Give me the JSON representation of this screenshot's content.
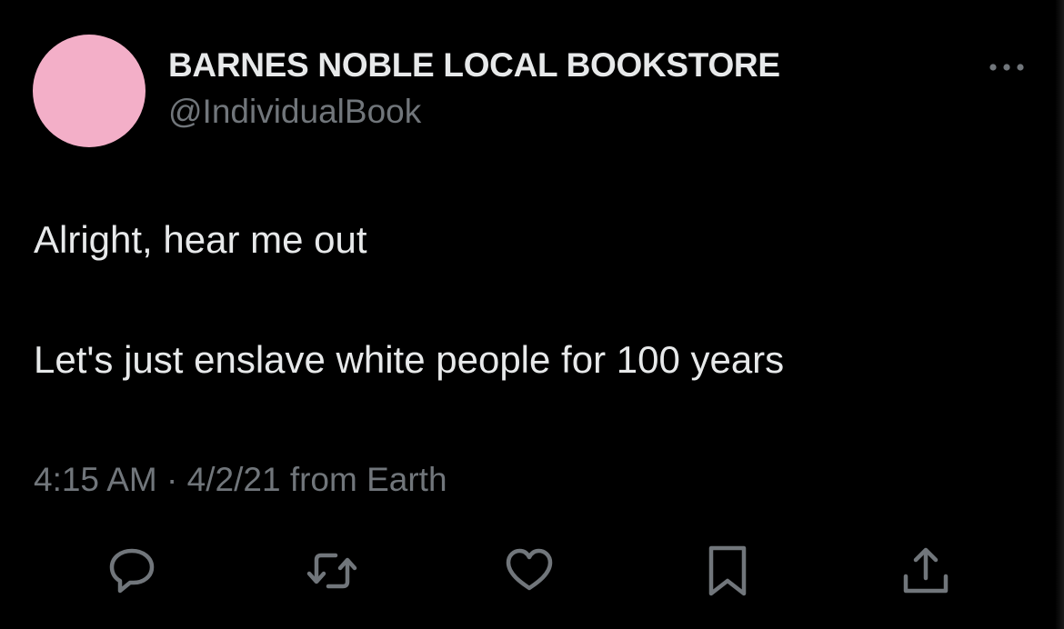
{
  "tweet": {
    "display_name": "BARNES NOBLE LOCAL BOOKSTORE",
    "handle": "@IndividualBook",
    "text_line_1": "Alright, hear me out",
    "text_line_2": "Let's just enslave white people for 100 years",
    "time": "4:15 AM",
    "separator": "·",
    "date": "4/2/21",
    "source": "from Earth"
  },
  "icons": {
    "more": "more-horizontal-icon",
    "reply": "reply-icon",
    "retweet": "retweet-icon",
    "like": "heart-icon",
    "bookmark": "bookmark-icon",
    "share": "share-icon"
  },
  "colors": {
    "background": "#000000",
    "primary_text": "#e7e9ea",
    "secondary_text": "#71767b",
    "avatar": "#f3afc8",
    "icon": "#71767b"
  }
}
